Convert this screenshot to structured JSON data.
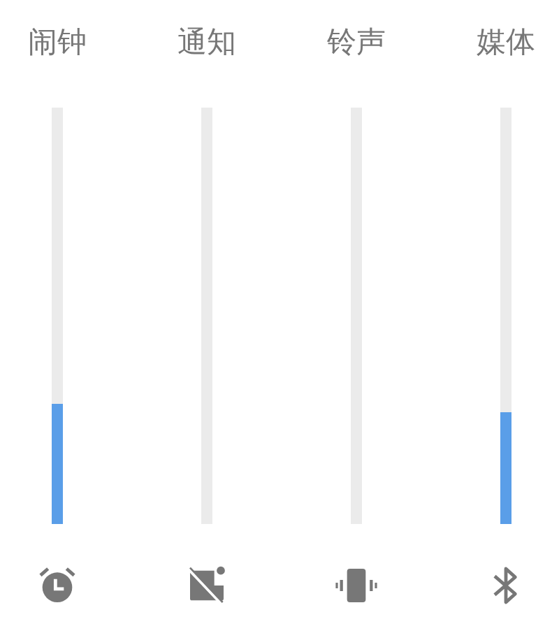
{
  "channels": [
    {
      "label": "闹钟",
      "level": 0.29,
      "kind": "alarm"
    },
    {
      "label": "通知",
      "kind": "notification-off"
    },
    {
      "label": "铃声",
      "kind": "vibrate"
    },
    {
      "label": "媒体",
      "level": 0.27,
      "kind": "bluetooth"
    }
  ]
}
